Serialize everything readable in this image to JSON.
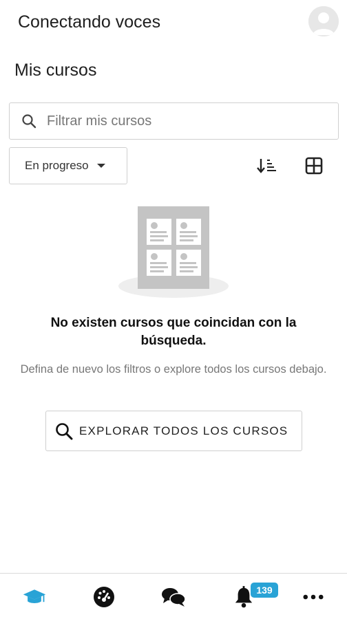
{
  "header": {
    "app_title": "Conectando voces",
    "avatar_icon": "user-avatar-icon"
  },
  "page": {
    "title": "Mis cursos"
  },
  "search": {
    "placeholder": "Filtrar mis cursos",
    "value": "",
    "icon": "search-icon"
  },
  "toolbar": {
    "filter_label": "En progreso",
    "sort_icon": "sort-icon",
    "view_icon": "grid-view-icon"
  },
  "empty_state": {
    "title": "No existen cursos que coincidan con la búsqueda.",
    "description": "Defina de nuevo los filtros o explore todos los cursos debajo.",
    "button_label": "EXPLORAR TODOS LOS CURSOS"
  },
  "bottom_nav": {
    "items": [
      {
        "name": "courses",
        "icon": "graduation-cap-icon",
        "active": true
      },
      {
        "name": "dashboard",
        "icon": "dashboard-gauge-icon",
        "active": false
      },
      {
        "name": "messages",
        "icon": "chat-bubbles-icon",
        "active": false
      },
      {
        "name": "notifications",
        "icon": "bell-icon",
        "active": false
      },
      {
        "name": "more",
        "icon": "more-dots-icon",
        "active": false
      }
    ],
    "notification_count": "139"
  },
  "colors": {
    "accent": "#29a3d6",
    "border": "#cfcfcf",
    "text": "#1f1f1f",
    "muted_text": "#777777"
  }
}
